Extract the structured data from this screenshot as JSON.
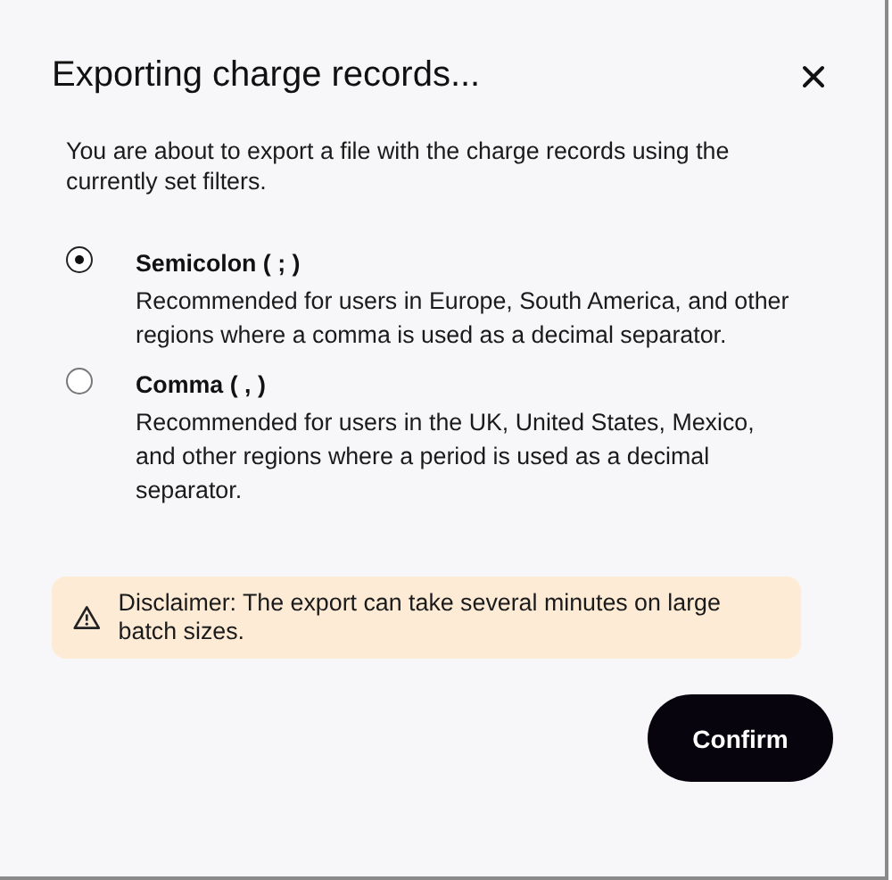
{
  "dialog": {
    "title": "Exporting charge records...",
    "intro": "You are about to export a file with the charge records using the currently set filters.",
    "options": [
      {
        "label": "Semicolon ( ; )",
        "description": "Recommended for users in Europe, South America, and other regions where a comma is used as a decimal separator.",
        "selected": true
      },
      {
        "label": "Comma ( , )",
        "description": "Recommended for users in the UK, United States, Mexico, and other regions where a period is used as a decimal separator.",
        "selected": false
      }
    ],
    "disclaimer": "Disclaimer: The export can take several minutes on large batch sizes.",
    "confirm": "Confirm"
  }
}
